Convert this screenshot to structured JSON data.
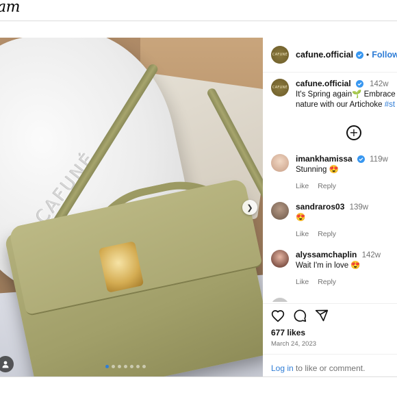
{
  "app": {
    "logo_text": "am"
  },
  "photo": {
    "brand_text": "CAFUNÉ",
    "carousel_count": 7,
    "carousel_active": 0
  },
  "post": {
    "author": "cafune.official",
    "separator": "•",
    "follow_label": "Follow",
    "caption": {
      "username": "cafune.official",
      "time": "142w",
      "line1_prefix": "It's Spring again",
      "line1_emoji": "🌱",
      "line1_suffix": "Embrace t",
      "line2_text": "nature with our Artichoke ",
      "line2_hashtag": "#st"
    },
    "comments": [
      {
        "username": "imankhamissa",
        "verified": true,
        "time": "119w",
        "text": "Stunning 😍",
        "like_label": "Like",
        "reply_label": "Reply"
      },
      {
        "username": "sandraros03",
        "verified": false,
        "time": "139w",
        "text": "😍",
        "like_label": "Like",
        "reply_label": "Reply"
      },
      {
        "username": "alyssamchaplin",
        "verified": false,
        "time": "142w",
        "text": "Wait I'm in love 😍",
        "like_label": "Like",
        "reply_label": "Reply"
      }
    ],
    "likes": "677 likes",
    "date": "March 24, 2023",
    "login_link": "Log in",
    "login_text": " to like or comment."
  },
  "icons": {
    "like": "heart-icon",
    "comment": "comment-icon",
    "share": "share-icon",
    "add": "plus-circle-icon",
    "verified": "verified-badge-icon",
    "next": "chevron-right-icon",
    "tag": "user-tag-icon"
  },
  "colors": {
    "accent": "#2f7dd6",
    "muted": "#737373",
    "verified": "#3897f0"
  }
}
